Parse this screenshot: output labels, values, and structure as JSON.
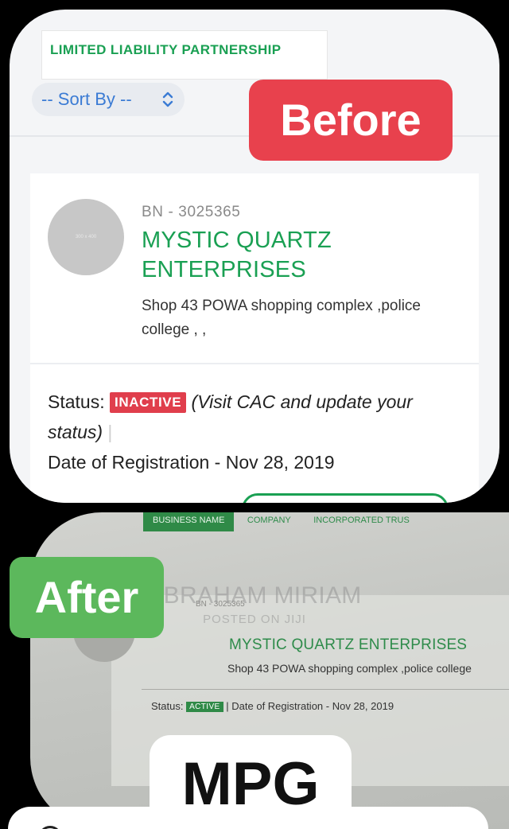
{
  "before": {
    "badge": "Before",
    "llp_tab": "LIMITED LIABILITY PARTNERSHIP",
    "sort_label": "-- Sort By --",
    "avatar_placeholder": "300 x 400",
    "bn_number": "BN - 3025365",
    "business_name": "MYSTIC QUARTZ ENTERPRISES",
    "address": "Shop 43 POWA shopping complex ,police college , ,",
    "status_label": "Status:",
    "status_value": "INACTIVE",
    "status_note": "(Visit CAC and update your status)",
    "separator": "|",
    "registration": "Date of Registration - Nov 28, 2019",
    "colors": {
      "green": "#1aa053",
      "red": "#e8414d",
      "blue": "#3b7bd4"
    }
  },
  "after": {
    "badge": "After",
    "tabs": [
      "BUSINESS NAME",
      "COMPANY",
      "INCORPORATED TRUS"
    ],
    "watermark_name": "ABRAHAM MIRIAM",
    "watermark_sub": "POSTED ON JIJI",
    "avatar_placeholder": "300 x 400",
    "bn_number": "BN - 3025365",
    "business_name": "MYSTIC QUARTZ ENTERPRISES",
    "address": "Shop 43 POWA shopping complex ,police college",
    "status_label": "Status:",
    "status_value": "ACTIVE",
    "separator": "|",
    "registration": "Date of Registration - Nov 28, 2019",
    "colors": {
      "green": "#2f8a47",
      "badge": "#5cb85c"
    }
  },
  "footer": {
    "mpg": "MPG"
  }
}
